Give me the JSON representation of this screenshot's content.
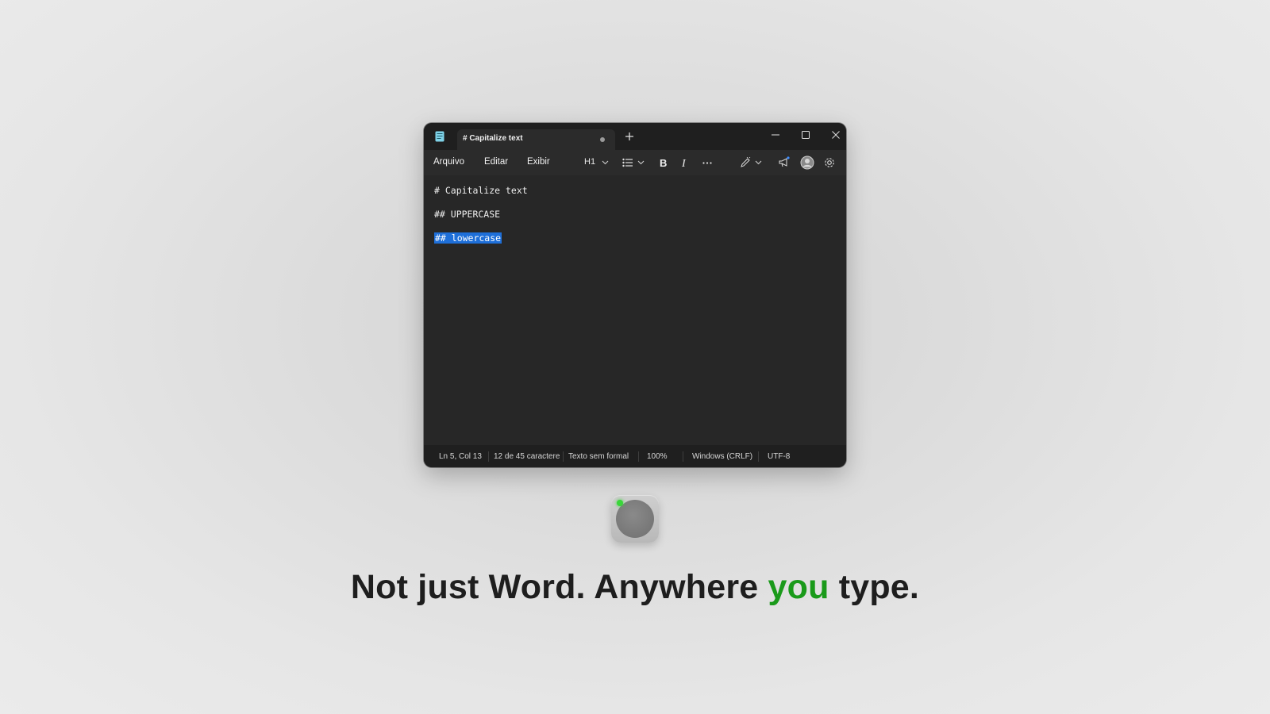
{
  "tab": {
    "title": "# Capitalize text"
  },
  "menu": [
    "Arquivo",
    "Editar",
    "Exibir"
  ],
  "toolbar": {
    "heading": "H1"
  },
  "editor": {
    "lines": [
      "# Capitalize text",
      "## UPPERCASE",
      "## lowercase"
    ],
    "selected_line": 3
  },
  "status": {
    "position": "Ln 5, Col 13",
    "chars": "12 de 45 caractere",
    "format": "Texto sem formal",
    "zoom": "100%",
    "line_ending": "Windows (CRLF)",
    "encoding": "UTF-8"
  },
  "tagline": {
    "before": "Not just Word. Anywhere ",
    "accent": "you",
    "after": " type."
  },
  "colors": {
    "accent_green": "#1a9a1a",
    "selection_blue": "#1e6fd9",
    "record_indicator": "#39d639"
  },
  "icons": [
    "notepad-icon",
    "plus-icon",
    "minimize-icon",
    "maximize-icon",
    "close-icon",
    "chevron-down-icon",
    "list-icon",
    "bold-icon",
    "italic-icon",
    "more-icon",
    "pen-icon",
    "megaphone-icon",
    "avatar-icon",
    "gear-icon"
  ]
}
